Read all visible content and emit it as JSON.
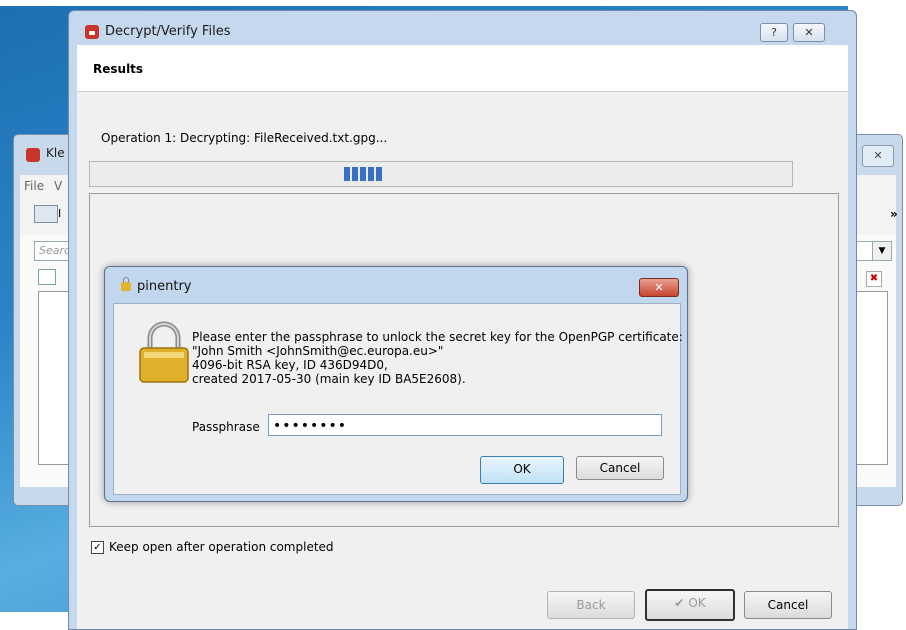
{
  "kleopatra": {
    "title": "Kle",
    "close": "✕",
    "menu_file": "File",
    "menu_v": "V",
    "toolbar_label": "I",
    "overflow": "»",
    "search_placeholder": "Searc",
    "dropdown": "▼",
    "delete_icon": "✖"
  },
  "dialog": {
    "title": "Decrypt/Verify Files",
    "help_button": "?",
    "close_button": "✕",
    "header": "Results",
    "operation": "Operation 1: Decrypting: FileReceived.txt.gpg...",
    "keep_open_label": "Keep open after operation completed",
    "keep_open_checked": "✓",
    "back_label": "Back",
    "ok_label": "OK",
    "ok_check": "✔",
    "cancel_label": "Cancel"
  },
  "pinentry": {
    "title": "pinentry",
    "close_button": "✕",
    "message": [
      "Please enter the passphrase to unlock the secret key for the OpenPGP certificate:",
      "\"John Smith <JohnSmith@ec.europa.eu>\"",
      "4096-bit RSA key, ID 436D94D0,",
      "created 2017-05-30 (main key ID BA5E2608)."
    ],
    "passphrase_label": "Passphrase",
    "passphrase_value": "••••••••",
    "ok_label": "OK",
    "cancel_label": "Cancel"
  },
  "colors": {
    "accent": "#3a6fc6",
    "close_red": "#c7452f",
    "lock_gold": "#e3b52b"
  }
}
